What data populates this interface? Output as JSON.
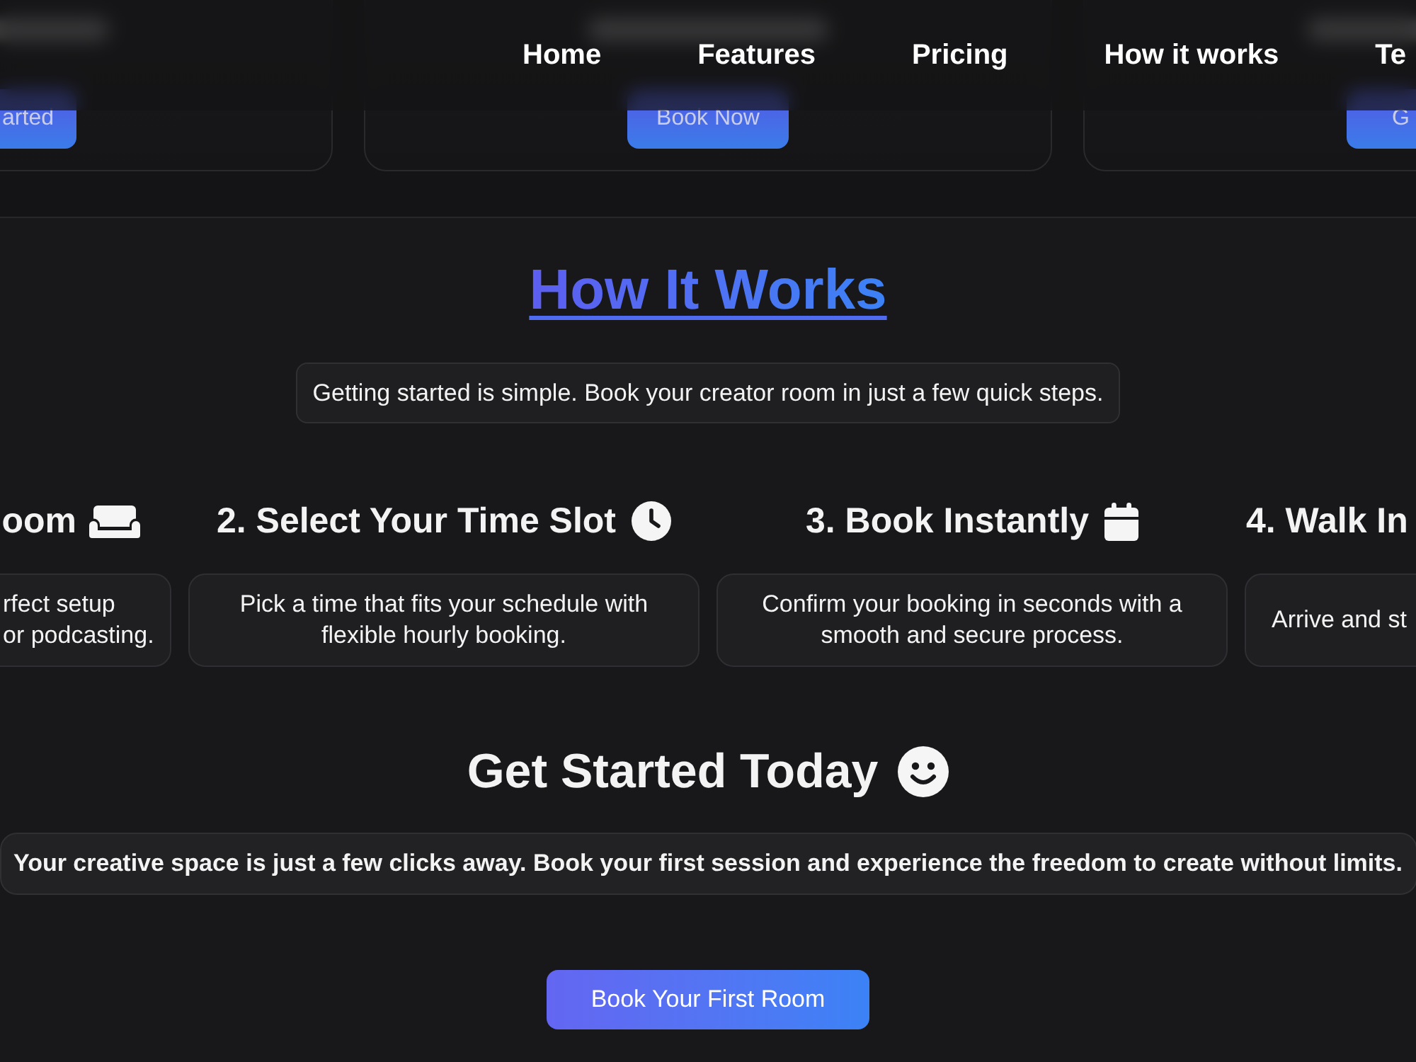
{
  "nav": {
    "links": [
      "Home",
      "Features",
      "Pricing",
      "How it works",
      "Te"
    ]
  },
  "pricing_cards": [
    {
      "button": "arted"
    },
    {
      "button": "Book Now"
    },
    {
      "button": "G"
    }
  ],
  "how_it_works": {
    "title": "How It Works",
    "subtitle": "Getting started is simple. Book your creator room in just a few quick steps.",
    "steps": [
      {
        "title": "oom",
        "description": "rfect setup\nor podcasting."
      },
      {
        "title": "2. Select Your Time Slot",
        "description": "Pick a time that fits your schedule with flexible hourly booking."
      },
      {
        "title": "3. Book Instantly",
        "description": "Confirm your booking in seconds with a smooth and secure process."
      },
      {
        "title": "4. Walk In",
        "description": "Arrive and st"
      }
    ]
  },
  "get_started": {
    "title": "Get Started Today",
    "text": "Your creative space is just a few clicks away. Book your first session and experience the freedom to create without limits.",
    "button": "Book Your First Room"
  }
}
